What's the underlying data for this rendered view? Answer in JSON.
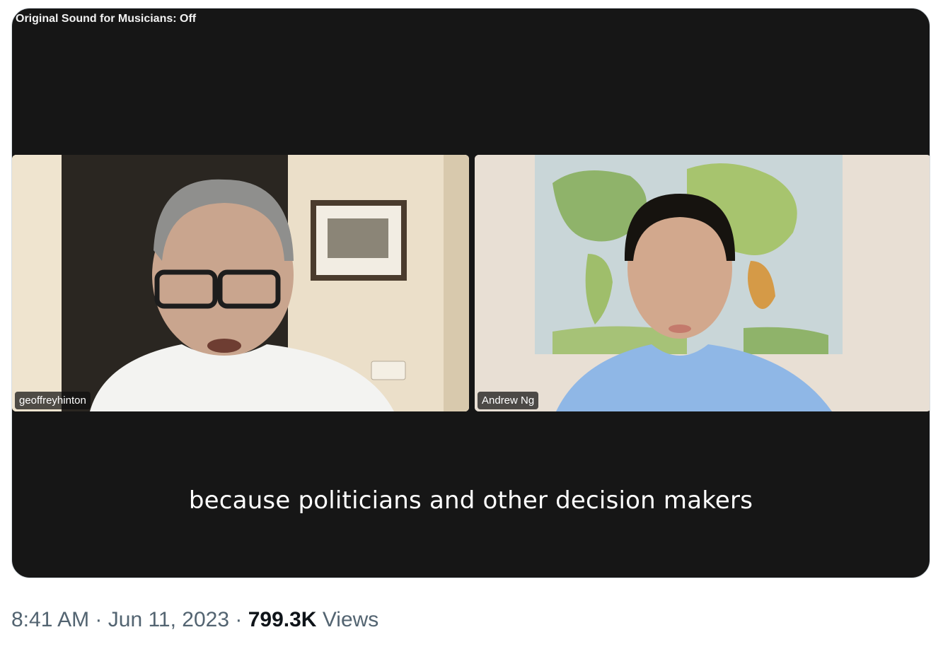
{
  "video": {
    "status_overlay": "Original Sound for Musicians: Off",
    "caption": "because politicians and other decision makers",
    "participants": [
      {
        "name": "geoffreyhinton"
      },
      {
        "name": "Andrew Ng"
      }
    ]
  },
  "meta": {
    "time": "8:41 AM",
    "separator": "·",
    "date": "Jun 11, 2023",
    "views_count": "799.3K",
    "views_label": "Views"
  }
}
